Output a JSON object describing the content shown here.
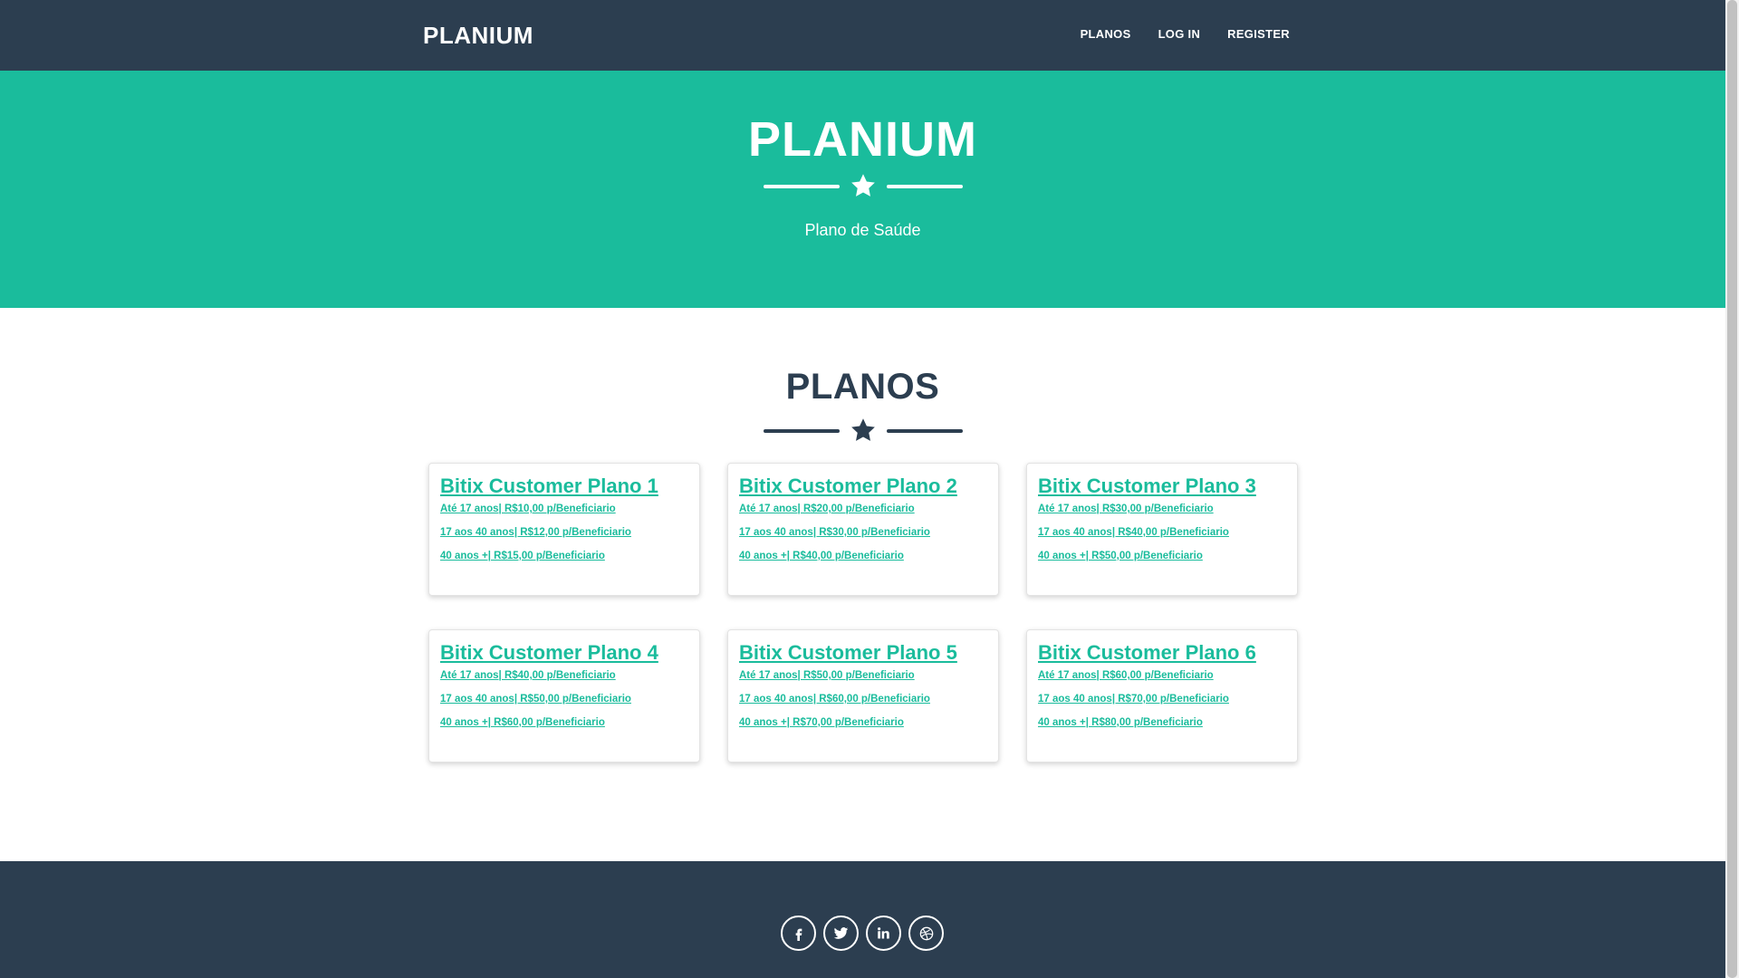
{
  "navbar": {
    "brand": "PLANIUM",
    "links": [
      "PLANOS",
      "LOG IN",
      "REGISTER"
    ]
  },
  "masthead": {
    "title": "PLANIUM",
    "subtitle": "Plano de Saúde"
  },
  "plans": {
    "title": "PLANOS",
    "cards": [
      {
        "title": "Bitix Customer Plano 1",
        "prices": [
          "Até 17 anos| R$10,00 p/Beneficiario",
          "17 aos 40 anos| R$12,00 p/Beneficiario",
          "40 anos +| R$15,00 p/Beneficiario"
        ]
      },
      {
        "title": "Bitix Customer Plano 2",
        "prices": [
          "Até 17 anos| R$20,00 p/Beneficiario",
          "17 aos 40 anos| R$30,00 p/Beneficiario",
          "40 anos +| R$40,00 p/Beneficiario"
        ]
      },
      {
        "title": "Bitix Customer Plano 3",
        "prices": [
          "Até 17 anos| R$30,00 p/Beneficiario",
          "17 aos 40 anos| R$40,00 p/Beneficiario",
          "40 anos +| R$50,00 p/Beneficiario"
        ]
      },
      {
        "title": "Bitix Customer Plano 4",
        "prices": [
          "Até 17 anos| R$40,00 p/Beneficiario",
          "17 aos 40 anos| R$50,00 p/Beneficiario",
          "40 anos +| R$60,00 p/Beneficiario"
        ]
      },
      {
        "title": "Bitix Customer Plano 5",
        "prices": [
          "Até 17 anos| R$50,00 p/Beneficiario",
          "17 aos 40 anos| R$60,00 p/Beneficiario",
          "40 anos +| R$70,00 p/Beneficiario"
        ]
      },
      {
        "title": "Bitix Customer Plano 6",
        "prices": [
          "Até 17 anos| R$60,00 p/Beneficiario",
          "17 aos 40 anos| R$70,00 p/Beneficiario",
          "40 anos +| R$80,00 p/Beneficiario"
        ]
      }
    ]
  },
  "footer": {
    "social_icons": [
      "facebook-icon",
      "twitter-icon",
      "linkedin-icon",
      "dribbble-icon"
    ]
  },
  "colors": {
    "navy": "#2c3e50",
    "teal": "#1abc9c",
    "white": "#ffffff"
  }
}
